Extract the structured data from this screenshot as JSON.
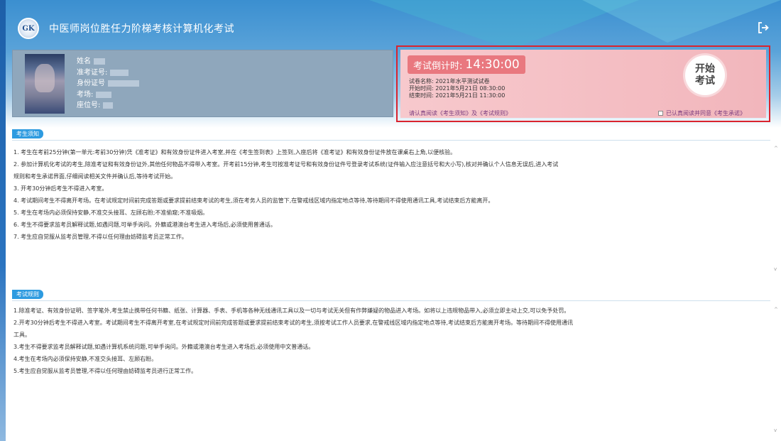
{
  "header": {
    "logo_text": "GK",
    "title": "中医师岗位胜任力阶梯考核计算机化考试"
  },
  "candidate": {
    "name_label": "姓名",
    "ticket_label": "准考证号:",
    "id_label": "身份证号",
    "room_label": "考场:",
    "seat_label": "座位号:"
  },
  "exam": {
    "countdown_label": "考试倒计时:",
    "countdown_value": "14:30:00",
    "paper_name": "试卷名称: 2021年水平测试试卷",
    "start_time": "开始时间: 2021年5月21日 08:30:00",
    "end_time": "结束时间: 2021年5月21日 11:30:00",
    "read_notice": "请认真阅读《考生须知》及《考试规则》",
    "start_button_line1": "开始",
    "start_button_line2": "考试",
    "agree_text": "已认真阅读并同意《考生承诺》"
  },
  "notice": {
    "tag": "考生须知",
    "lines": [
      "1. 考生在考前25分钟(第一单元:考前30分钟)凭《准考证》和有效身份证件进入考室,并在《考生签到表》上签到,入座后将《准考证》和有效身份证件放在课桌右上角,以便核验。",
      "2. 参加计算机化考试的考生,除准考证和有效身份证外,其他任何物品不得带入考室。开考前15分钟,考生可按准考证号和有效身份证件号登录考试系统(证件输入应注意括号和大小写),核对并确认个人信息无误后,进入考试",
      "规则和考生承诺界面,仔细阅读相关文件并确认后,等待考试开始。",
      "3. 开考30分钟后考生不得进入考室。",
      "4. 考试期间考生不得离开考场。在考试规定时间前完成答题或要求提前结束考试的考生,须在考务人员的监管下,在警戒线区域内指定地点等待,等待期间不得使用通讯工具,考试结束后方能离开。",
      "5. 考生在考场内必须保持安静,不准交头接耳、左顾右盼;不准偷窥;不准吸烟。",
      "6. 考生不得要求监考员解释试题,如遇问题,可举手询问。外籍或港澳台考生进入考场后,必须使用普通话。",
      "7. 考生应自觉服从监考员管理,不得以任何理由妨碍监考员正常工作。"
    ]
  },
  "rules": {
    "tag": "考试规则",
    "lines": [
      "1.除准考证、有效身份证明、签字笔外,考生禁止携带任何书籍、纸张、计算器、手表、手机等各种无线通讯工具以及一切与考试无关但有作弊嫌疑的物品进入考场。如将以上违规物品带入,必须立即主动上交,可以免予处罚。",
      "2.开考30分钟后考生不得进入考室。考试期间考生不得离开考室,在考试规定时间前完成答题或要求提前结束考试的考生,须按考试工作人员要求,在警戒线区域内指定地点等待,考试结束后方能离开考场。等待期间不得使用通讯",
      "工具。",
      "3.考生不得要求监考员解释试题,如遇计算机系统问题,可举手询问。外籍或港澳台考生进入考场后,必须使用中文普通话。",
      "4.考生在考场内必须保持安静,不准交头接耳、左顾右盼。",
      "5.考生应自觉服从监考员管理,不得以任何理由妨碍监考员进行正常工作。"
    ]
  },
  "colors": {
    "accent": "#2e9be0",
    "highlight_border": "#d9232e",
    "countdown_bg": "#e9787f"
  }
}
